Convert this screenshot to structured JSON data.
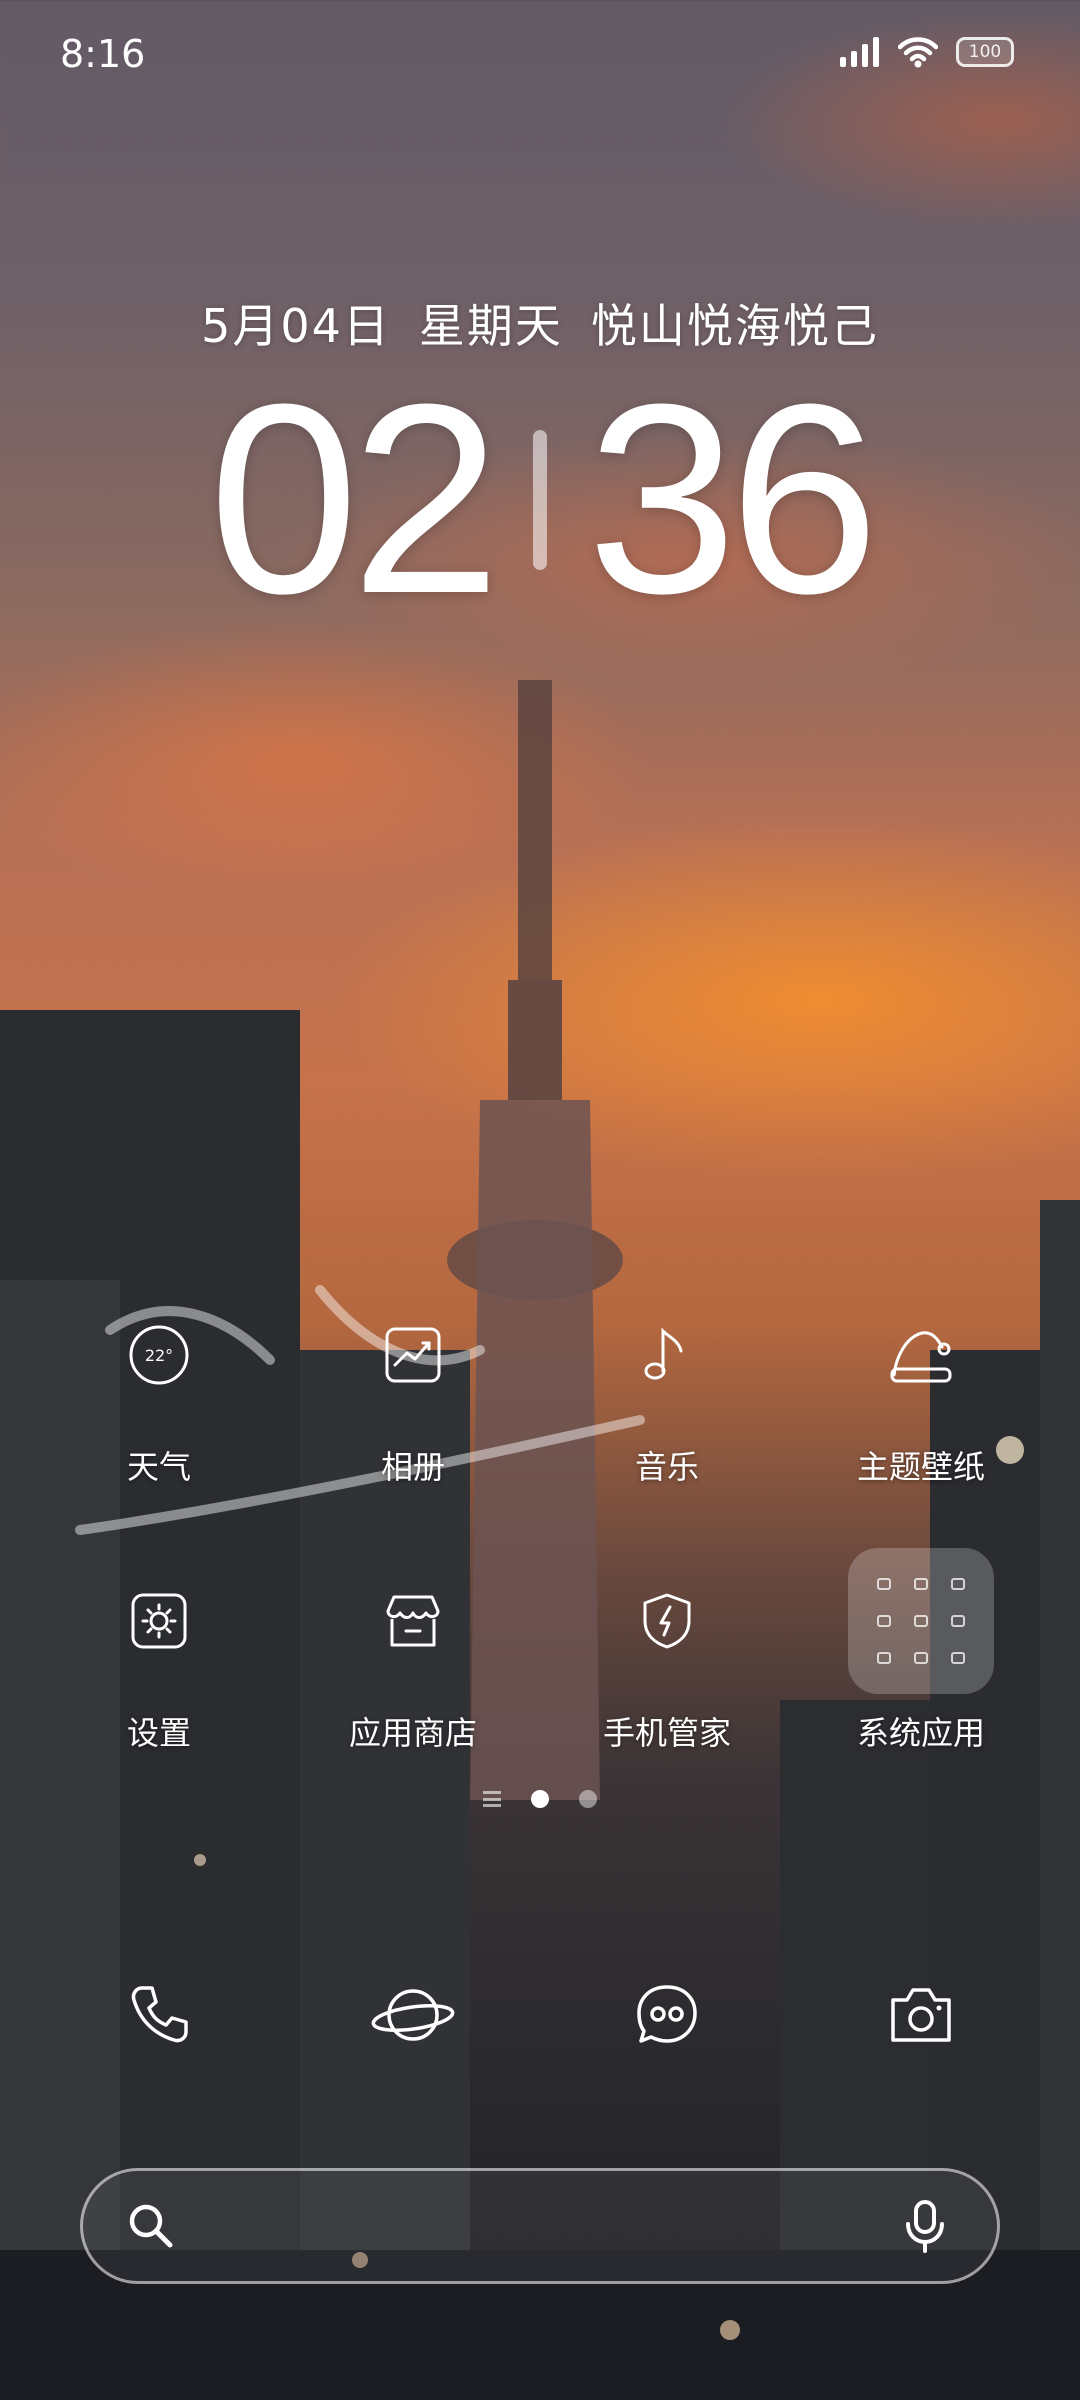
{
  "status_bar": {
    "time": "8:16",
    "battery_level": "100",
    "icons": [
      "signal-icon",
      "wifi-icon",
      "battery-icon"
    ]
  },
  "lockscreen_widget": {
    "date": "5月04日",
    "weekday": "星期天",
    "motto": "悦山悦海悦己",
    "hour": "02",
    "minute": "36"
  },
  "apps": [
    {
      "label": "天气",
      "icon": "weather-icon",
      "temperature": "22°"
    },
    {
      "label": "相册",
      "icon": "gallery-icon"
    },
    {
      "label": "音乐",
      "icon": "music-icon"
    },
    {
      "label": "主题壁纸",
      "icon": "theme-icon"
    },
    {
      "label": "设置",
      "icon": "settings-icon"
    },
    {
      "label": "应用商店",
      "icon": "app-store-icon"
    },
    {
      "label": "手机管家",
      "icon": "phone-manager-icon"
    },
    {
      "label": "系统应用",
      "icon": "folder-icon"
    }
  ],
  "pages": {
    "count": 2,
    "active": 1
  },
  "dock": [
    {
      "icon": "phone-icon"
    },
    {
      "icon": "browser-icon"
    },
    {
      "icon": "messages-icon"
    },
    {
      "icon": "camera-icon"
    }
  ],
  "search_bar": {
    "icons": [
      "search-icon",
      "microphone-icon"
    ]
  },
  "colors": {
    "text": "#ffffff",
    "sky_orange": "#c6724b",
    "sky_top": "#625a66"
  }
}
